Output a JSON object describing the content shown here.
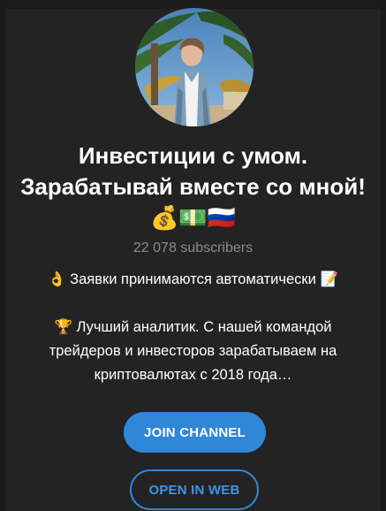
{
  "channel": {
    "avatar_alt": "channel avatar",
    "title": "Инвестиции с умом. Зарабатывай вместе со мной!💰💵🇷🇺",
    "subscribers": "22 078 subscribers",
    "description_line1": "👌 Заявки принимаются автоматически 📝",
    "description_line2": "🏆 Лучший аналитик. С нашей командой трейдеров и инвесторов зарабатываем на криптовалютах с 2018 года…"
  },
  "actions": {
    "join_label": "JOIN CHANNEL",
    "open_web_label": "OPEN IN WEB"
  },
  "colors": {
    "background": "#232323",
    "accent": "#2f87d8",
    "muted_text": "#8b8b8b"
  }
}
